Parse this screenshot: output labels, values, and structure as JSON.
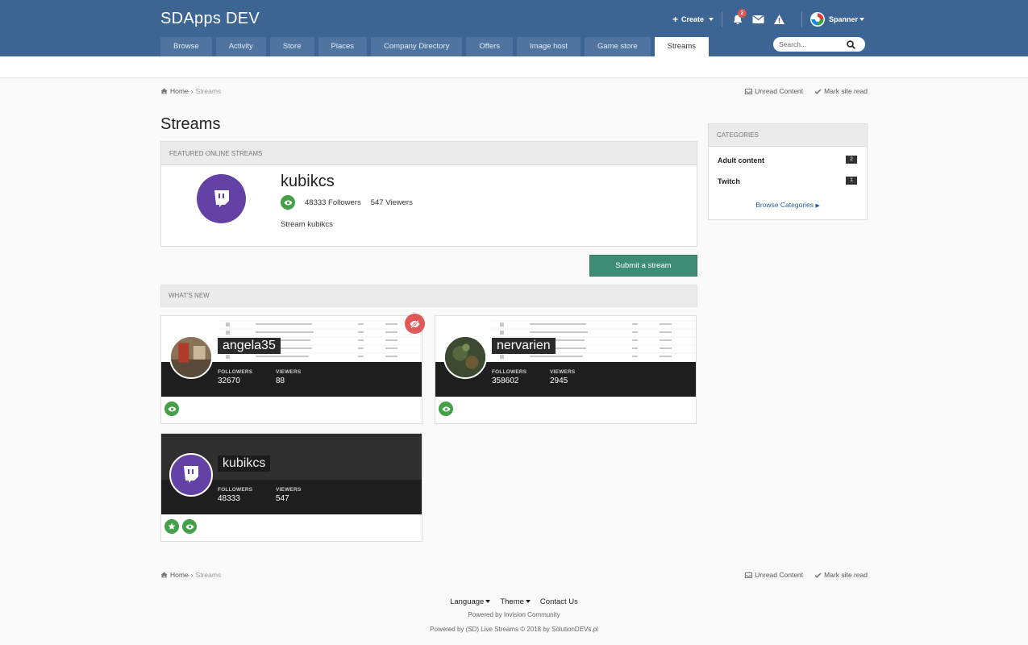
{
  "site": {
    "title": "SDApps DEV"
  },
  "user_bar": {
    "create_label": "Create",
    "notification_count": "2",
    "username": "Spanner"
  },
  "nav": {
    "tabs": [
      {
        "label": "Browse"
      },
      {
        "label": "Activity"
      },
      {
        "label": "Store"
      },
      {
        "label": "Places"
      },
      {
        "label": "Company Directory"
      },
      {
        "label": "Offers"
      },
      {
        "label": "Image host"
      },
      {
        "label": "Game store"
      },
      {
        "label": "Streams"
      }
    ],
    "active": "Streams"
  },
  "search": {
    "placeholder": "Search..."
  },
  "breadcrumb": {
    "home": "Home",
    "current": "Streams",
    "unread": "Unread Content",
    "mark_read": "Mark site read"
  },
  "page": {
    "title": "Streams"
  },
  "featured": {
    "heading": "Featured Online Streams",
    "name": "kubikcs",
    "followers": "48333 Followers",
    "viewers": "547 Viewers",
    "description": "Stream kubikcs"
  },
  "submit_label": "Submit a stream",
  "whats_new": {
    "heading": "What's New"
  },
  "streams": [
    {
      "name": "angela35",
      "followers_label": "FOLLOWERS",
      "followers": "32670",
      "viewers_label": "VIEWERS",
      "viewers": "88"
    },
    {
      "name": "nervarien",
      "followers_label": "FOLLOWERS",
      "followers": "358602",
      "viewers_label": "VIEWERS",
      "viewers": "2945"
    },
    {
      "name": "kubikcs",
      "followers_label": "FOLLOWERS",
      "followers": "48333",
      "viewers_label": "VIEWERS",
      "viewers": "547"
    }
  ],
  "categories": {
    "heading": "Categories",
    "items": [
      {
        "label": "Adult content",
        "count": "2"
      },
      {
        "label": "Twitch",
        "count": "1"
      }
    ],
    "browse_label": "Browse Categories"
  },
  "footer": {
    "language": "Language",
    "theme": "Theme",
    "contact": "Contact Us",
    "powered_by": "Powered by Invision Community",
    "powered_by_streams": "Powered by (SD) Live Streams © 2018 by SolutionDEVs.pl"
  },
  "colors": {
    "header": "#3d6594",
    "accent_green": "#3e8c74",
    "twitch_purple": "#6441a4",
    "offline_red": "#e05858"
  }
}
